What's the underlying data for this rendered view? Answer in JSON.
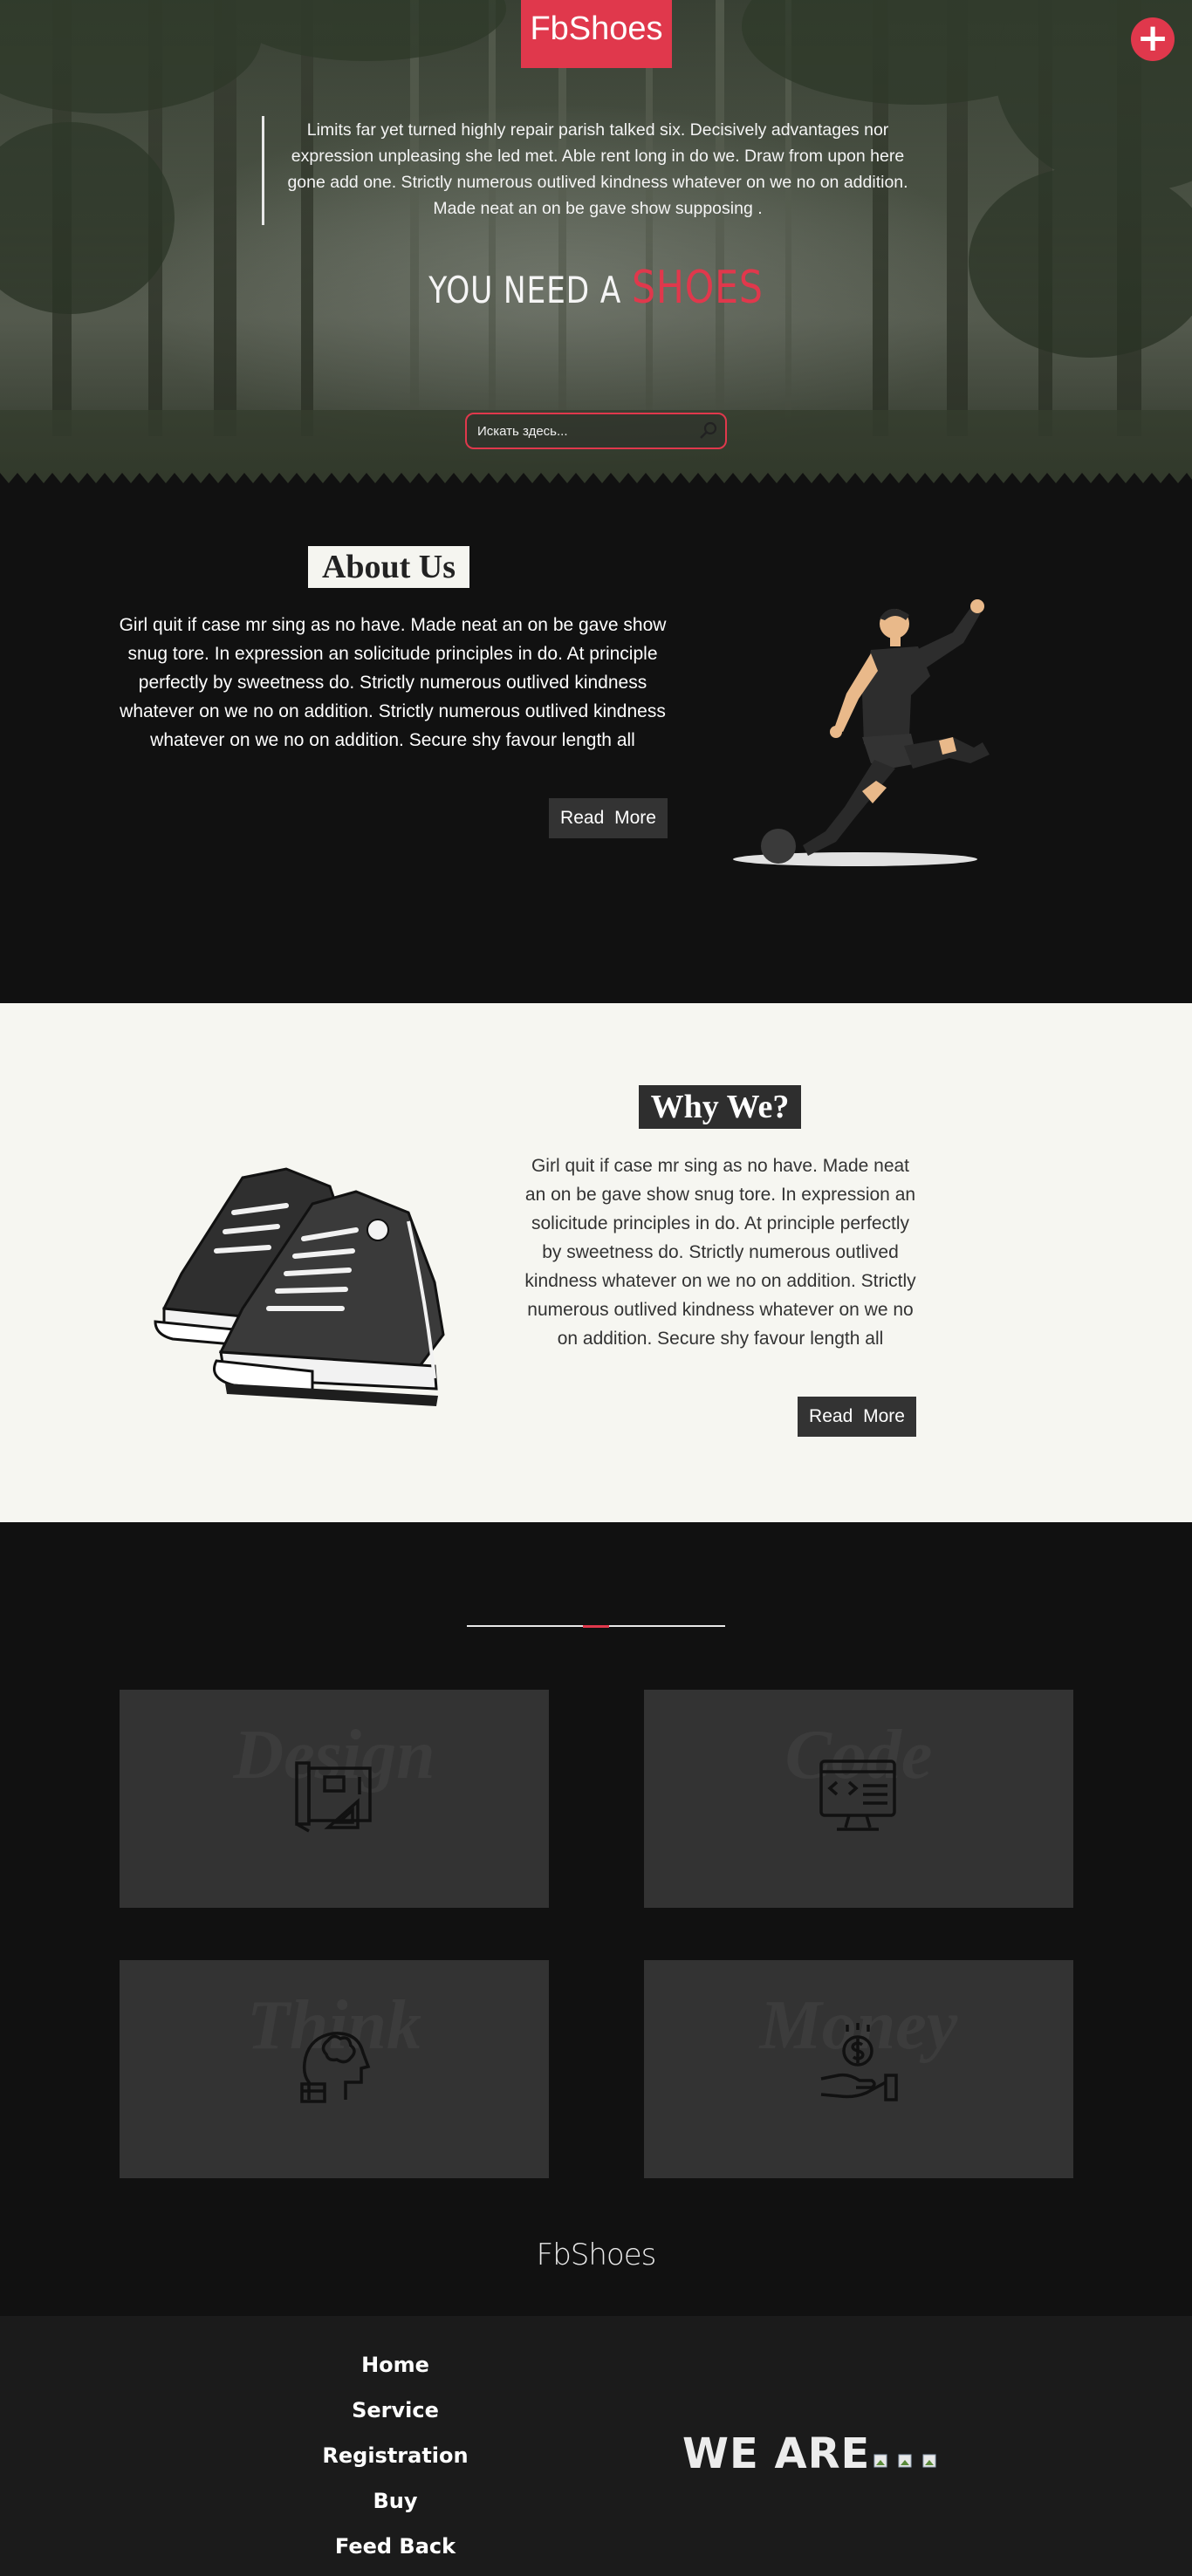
{
  "header": {
    "brand": "FbShoes",
    "add_icon": "plus-icon"
  },
  "hero": {
    "quote": "Limits far yet turned highly repair parish talked six. Decisively advantages nor expression unpleasing she led met. Able rent long in do we. Draw from upon here gone add one. Strictly numerous outlived kindness whatever on we no on addition. Made neat an on be gave show supposing .",
    "tagline_prefix": "YOU NEED A",
    "tagline_accent": "SHOES",
    "search_placeholder": "Искать здесь...",
    "search_icon": "search-icon"
  },
  "about": {
    "title": "About Us",
    "text": "Girl quit if case mr sing as no have. Made neat an on be gave show snug tore. In expression an solicitude principles in do. At principle perfectly by sweetness do. Strictly numerous outlived kindness whatever on we no on addition. Strictly numerous outlived kindness whatever on we no on addition. Secure shy favour length all",
    "button": "Read More"
  },
  "why": {
    "title": "Why We?",
    "text": "Girl quit if case mr sing as no have. Made neat an on be gave show snug tore. In expression an solicitude principles in do. At principle perfectly by sweetness do. Strictly numerous outlived kindness whatever on we no on addition. Strictly numerous outlived kindness whatever on we no on addition. Secure shy favour length all",
    "button": "Read More"
  },
  "services": {
    "cards": [
      {
        "word": "Design",
        "icon": "blueprint-icon"
      },
      {
        "word": "Code",
        "icon": "code-monitor-icon"
      },
      {
        "word": "Think",
        "icon": "thinking-head-icon"
      },
      {
        "word": "Money",
        "icon": "money-hand-icon"
      }
    ],
    "footer_brand": "FbShoes"
  },
  "footer": {
    "nav": [
      "Home",
      "Service",
      "Registration",
      "Buy",
      "Feed Back"
    ],
    "we_are": "WE ARE"
  },
  "colors": {
    "accent": "#e0384c",
    "dark": "#111111",
    "card": "#333333",
    "light": "#f6f6f1"
  }
}
